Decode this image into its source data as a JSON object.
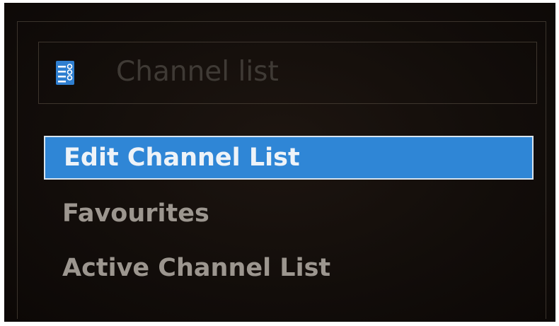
{
  "menu": {
    "title": "Channel list",
    "title_icon": "channel-list-icon",
    "items": [
      {
        "label": "Edit Channel List",
        "selected": true
      },
      {
        "label": "Favourites",
        "selected": false
      },
      {
        "label": "Active Channel List",
        "selected": false
      }
    ]
  },
  "colors": {
    "background": "#120c08",
    "highlight": "#2f86d6",
    "highlight_text": "#eef3f8",
    "item_text": "#9c968f",
    "title_text": "#3f3a35"
  }
}
